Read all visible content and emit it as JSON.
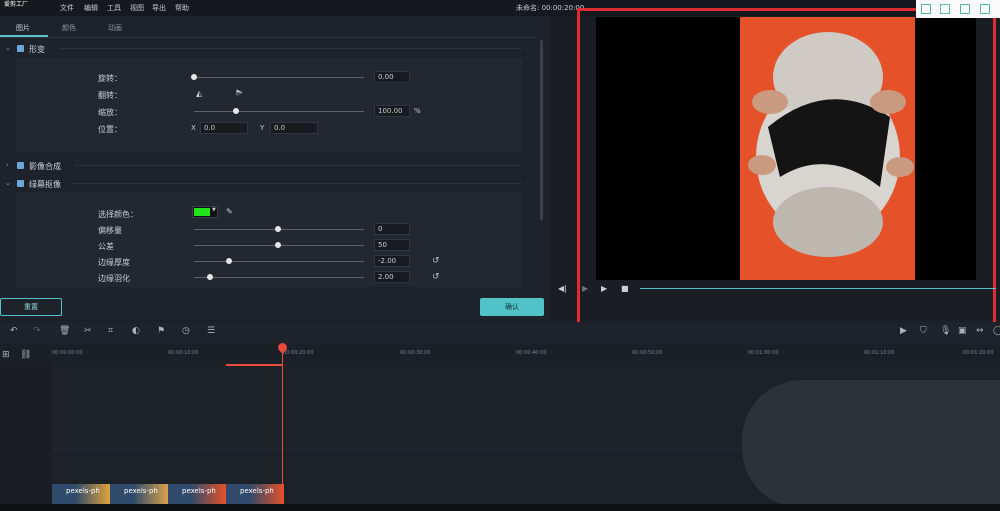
{
  "app": {
    "logo_text": "爱剪工厂",
    "project_label": "未命名: 00:00:20:00"
  },
  "menu": [
    "文件",
    "编辑",
    "工具",
    "视图",
    "导出",
    "帮助"
  ],
  "tabs": [
    "图片",
    "颜色",
    "动画"
  ],
  "sections": {
    "transform": "形变",
    "compositing": "影像合成",
    "chroma": "绿幕抠像"
  },
  "transform": {
    "rotate_label": "旋转：",
    "rotate_value": "0.00",
    "flip_label": "翻转：",
    "scale_label": "缩放：",
    "scale_value": "100.00",
    "scale_unit": "%",
    "position_label": "位置：",
    "x_label": "X",
    "x_value": "0.0",
    "y_label": "Y",
    "y_value": "0.0"
  },
  "chroma": {
    "color_label": "选择颜色：",
    "color_swatch": "#22e61a",
    "offset_label": "偏移量",
    "offset_value": "0",
    "tolerance_label": "公差",
    "tolerance_value": "50",
    "edge_thickness_label": "边缘厚度",
    "edge_thickness_value": "-2.00",
    "edge_feather_label": "边缘羽化",
    "edge_feather_value": "2.00"
  },
  "buttons": {
    "reset": "重置",
    "ok": "确认"
  },
  "timeline": {
    "ticks": [
      "00:00:00:00",
      "00:00:10:00",
      "00:00:20:00",
      "00:00:30:00",
      "00:00:40:00",
      "00:00:50:00",
      "00:01:00:00",
      "00:01:10:00",
      "00:01:20:00"
    ],
    "clips": [
      "pexels-ph",
      "pexels-ph",
      "pexels-ph",
      "pexels-ph"
    ]
  },
  "icons": {
    "undo": "undo-icon",
    "redo": "redo-icon",
    "delete": "trash-icon",
    "cut": "scissors-icon",
    "crop": "crop-icon",
    "color": "palette-icon",
    "marker": "marker-icon",
    "speed": "clock-icon",
    "adjust": "sliders-icon"
  },
  "colors": {
    "accent": "#4fc3c7",
    "highlight": "#e02b33",
    "playhead": "#e84a3b"
  }
}
